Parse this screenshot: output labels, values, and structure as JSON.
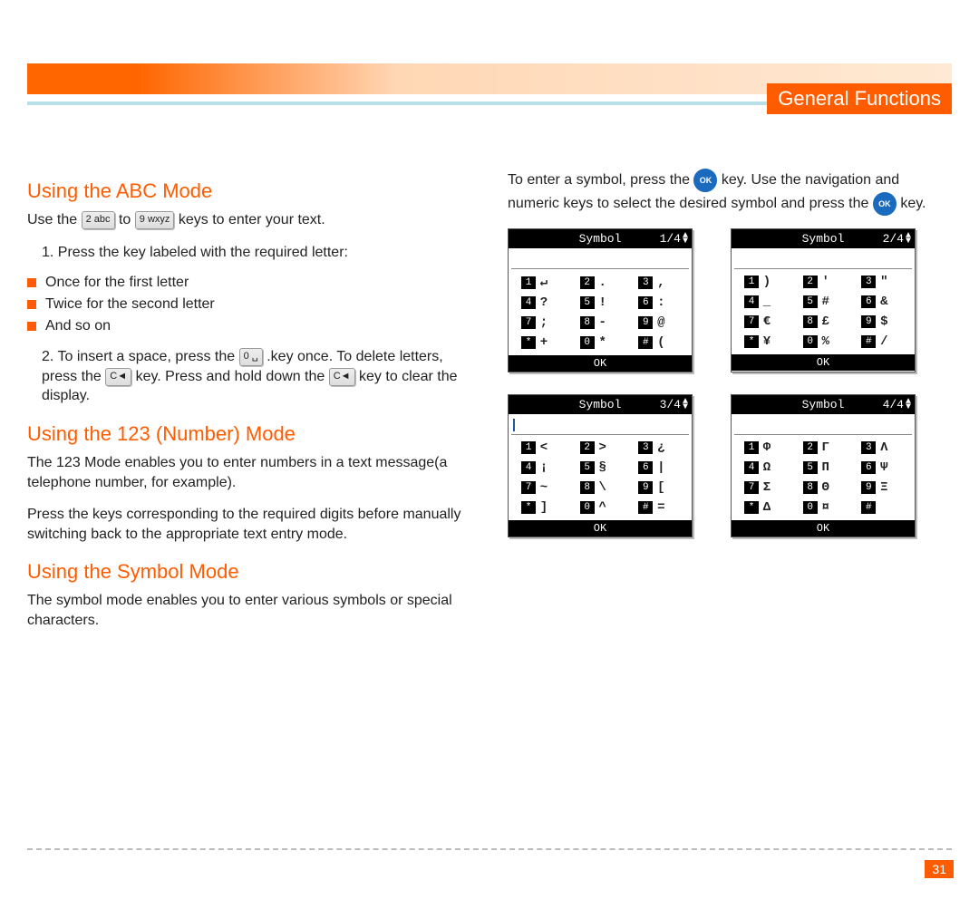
{
  "chapter_title": "General Functions",
  "page_number": "31",
  "abc": {
    "heading": "Using the ABC Mode",
    "intro_before": "Use the ",
    "key2": "2 abc",
    "intro_mid": " to ",
    "key9": "9 wxyz",
    "intro_after": " keys to enter your text.",
    "step1_label": "1. Press the key labeled with the required letter:",
    "bullets": [
      "Once for the first letter",
      "Twice for the second letter",
      "And so on"
    ],
    "step2_a": "2. To insert a space, press the ",
    "key0": "0 ␣",
    "step2_b": " .key once. To delete letters, press the ",
    "keyC1": "C◄",
    "step2_c": " key. Press and hold down the ",
    "keyC2": "C◄",
    "step2_d": " key to clear the display."
  },
  "num": {
    "heading": "Using the 123 (Number) Mode",
    "p1": "The 123 Mode enables you to enter numbers in a text message(a telephone number, for example).",
    "p2": "Press the keys corresponding to the required digits before manually switching back to the appropriate text entry mode."
  },
  "sym": {
    "heading": "Using the Symbol Mode",
    "p1": "The symbol mode enables you to enter various symbols or special characters.",
    "rightcol_a": "To enter a symbol, press the ",
    "ok1": "OK",
    "rightcol_b": " key. Use the navigation and numeric keys to select the desired symbol and press the ",
    "ok2": "OK",
    "rightcol_c": " key."
  },
  "keypad_labels": [
    "1",
    "2",
    "3",
    "4",
    "5",
    "6",
    "7",
    "8",
    "9",
    "*",
    "0",
    "#"
  ],
  "tables": [
    {
      "title": "Symbol",
      "page": "1/4",
      "cursor": false,
      "ok_label": "OK",
      "symbols": [
        "↵",
        ".",
        ",",
        "?",
        "!",
        ":",
        ";",
        "-",
        "@",
        "+",
        "*",
        "("
      ]
    },
    {
      "title": "Symbol",
      "page": "2/4",
      "cursor": false,
      "ok_label": "OK",
      "symbols": [
        ")",
        "'",
        "\"",
        "_",
        "#",
        "&",
        "€",
        "£",
        "$",
        "¥",
        "%",
        "/"
      ]
    },
    {
      "title": "Symbol",
      "page": "3/4",
      "cursor": true,
      "ok_label": "OK",
      "symbols": [
        "<",
        ">",
        "¿",
        "¡",
        "§",
        "|",
        "~",
        "\\",
        "[",
        "]",
        "^",
        "="
      ]
    },
    {
      "title": "Symbol",
      "page": "4/4",
      "cursor": false,
      "ok_label": "OK",
      "symbols": [
        "Φ",
        "Γ",
        "Λ",
        "Ω",
        "Π",
        "Ψ",
        "Σ",
        "Θ",
        "Ξ",
        "Δ",
        "¤",
        ""
      ]
    }
  ],
  "chart_data": {
    "type": "table",
    "title": "Symbol Mode key-to-symbol mapping",
    "key_labels": [
      "1",
      "2",
      "3",
      "4",
      "5",
      "6",
      "7",
      "8",
      "9",
      "*",
      "0",
      "#"
    ],
    "pages": [
      {
        "page": "1/4",
        "symbols": [
          "↵",
          ".",
          ",",
          "?",
          "!",
          ":",
          ";",
          "-",
          "@",
          "+",
          "*",
          "("
        ]
      },
      {
        "page": "2/4",
        "symbols": [
          ")",
          "'",
          "\"",
          "_",
          "#",
          "&",
          "€",
          "£",
          "$",
          "¥",
          "%",
          "/"
        ]
      },
      {
        "page": "3/4",
        "symbols": [
          "<",
          ">",
          "¿",
          "¡",
          "§",
          "|",
          "~",
          "\\",
          "[",
          "]",
          "^",
          "="
        ]
      },
      {
        "page": "4/4",
        "symbols": [
          "Φ",
          "Γ",
          "Λ",
          "Ω",
          "Π",
          "Ψ",
          "Σ",
          "Θ",
          "Ξ",
          "Δ",
          "¤",
          ""
        ]
      }
    ]
  }
}
